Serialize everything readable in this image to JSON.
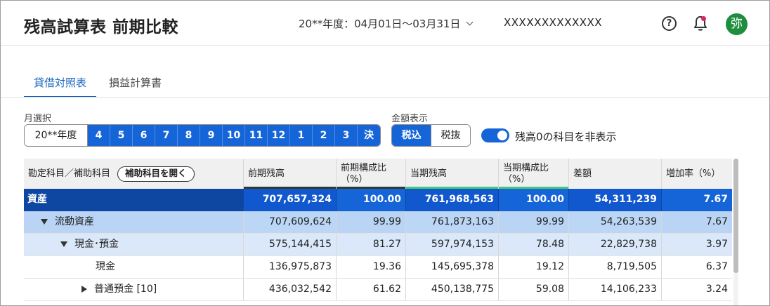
{
  "header": {
    "title": "残高試算表 前期比較",
    "period": "20**年度：04月01日〜03月31日",
    "company": "XXXXXXXXXXXXX",
    "help_glyph": "?",
    "avatar_text": "弥",
    "notification_dot_color": "#e0245e"
  },
  "tabs": [
    {
      "label": "貸借対照表",
      "active": true
    },
    {
      "label": "損益計算書",
      "active": false
    }
  ],
  "month_select": {
    "label": "月選択",
    "year_label": "20**年度",
    "months": [
      "4",
      "5",
      "6",
      "7",
      "8",
      "9",
      "10",
      "11",
      "12",
      "1",
      "2",
      "3",
      "決"
    ]
  },
  "amount_display": {
    "label": "金額表示",
    "options": [
      "税込",
      "税抜"
    ],
    "selected": "税込"
  },
  "hide_zero": {
    "label": "残高0の科目を非表示",
    "on": true
  },
  "table": {
    "headers": {
      "account": "勘定科目／補助科目",
      "open_sub_button": "補助科目を開く",
      "prev_balance": "前期残高",
      "prev_ratio": "前期構成比\n（%）",
      "cur_balance": "当期残高",
      "cur_ratio": "当期構成比\n（%）",
      "diff": "差額",
      "growth": "増加率（%）"
    },
    "rows": [
      {
        "name": "資産",
        "prev": "707,657,324",
        "prev_ratio": "100.00",
        "cur": "761,968,563",
        "cur_ratio": "100.00",
        "diff": "54,311,239",
        "growth": "7.67"
      },
      {
        "name": "流動資産",
        "prev": "707,609,624",
        "prev_ratio": "99.99",
        "cur": "761,873,163",
        "cur_ratio": "99.99",
        "diff": "54,263,539",
        "growth": "7.67"
      },
      {
        "name": "現金･預金",
        "prev": "575,144,415",
        "prev_ratio": "81.27",
        "cur": "597,974,153",
        "cur_ratio": "78.48",
        "diff": "22,829,738",
        "growth": "3.97"
      },
      {
        "name": "現金",
        "prev": "136,975,873",
        "prev_ratio": "19.36",
        "cur": "145,695,378",
        "cur_ratio": "19.12",
        "diff": "8,719,505",
        "growth": "6.37"
      },
      {
        "name": "普通預金 [10]",
        "prev": "436,032,542",
        "prev_ratio": "61.62",
        "cur": "450,138,775",
        "cur_ratio": "59.08",
        "diff": "14,106,233",
        "growth": "3.24"
      }
    ]
  },
  "colors": {
    "accent": "#1565d8",
    "asset_row": "#1565d8",
    "current_assets_row": "#b9d4f4",
    "cash_row": "#dbe8fa",
    "prev_header_bar": "#2e3b33",
    "cur_header_bar": "#43c77a"
  }
}
